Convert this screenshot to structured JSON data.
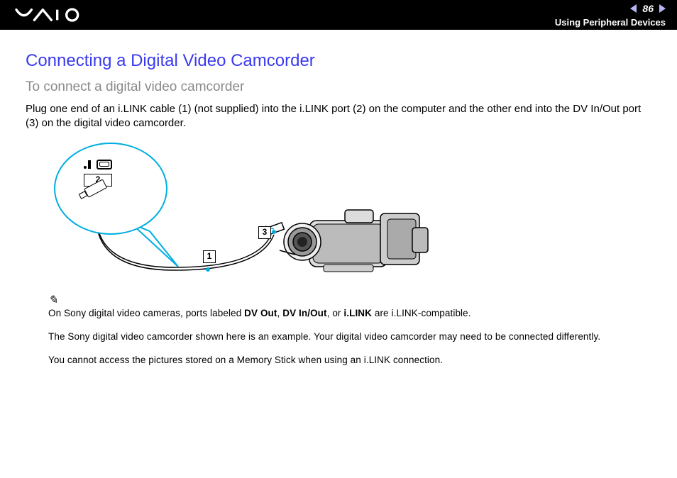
{
  "header": {
    "page_number": "86",
    "section": "Using Peripheral Devices"
  },
  "page": {
    "title": "Connecting a Digital Video Camcorder",
    "subtitle": "To connect a digital video camcorder",
    "intro": "Plug one end of an i.LINK cable (1) (not supplied) into the i.LINK port (2) on the computer and the other end into the DV In/Out port (3) on the digital video camcorder."
  },
  "diagram": {
    "callout_1": "1",
    "callout_2": "2",
    "callout_3": "3"
  },
  "notes": {
    "line1_pre": "On Sony digital video cameras, ports labeled ",
    "line1_b1": "DV Out",
    "line1_sep1": ", ",
    "line1_b2": "DV In/Out",
    "line1_sep2": ", or ",
    "line1_b3": "i.LINK",
    "line1_post": " are i.LINK-compatible.",
    "line2": "The Sony digital video camcorder shown here is an example. Your digital video camcorder may need to be connected differently.",
    "line3": "You cannot access the pictures stored on a Memory Stick when using an i.LINK connection."
  }
}
